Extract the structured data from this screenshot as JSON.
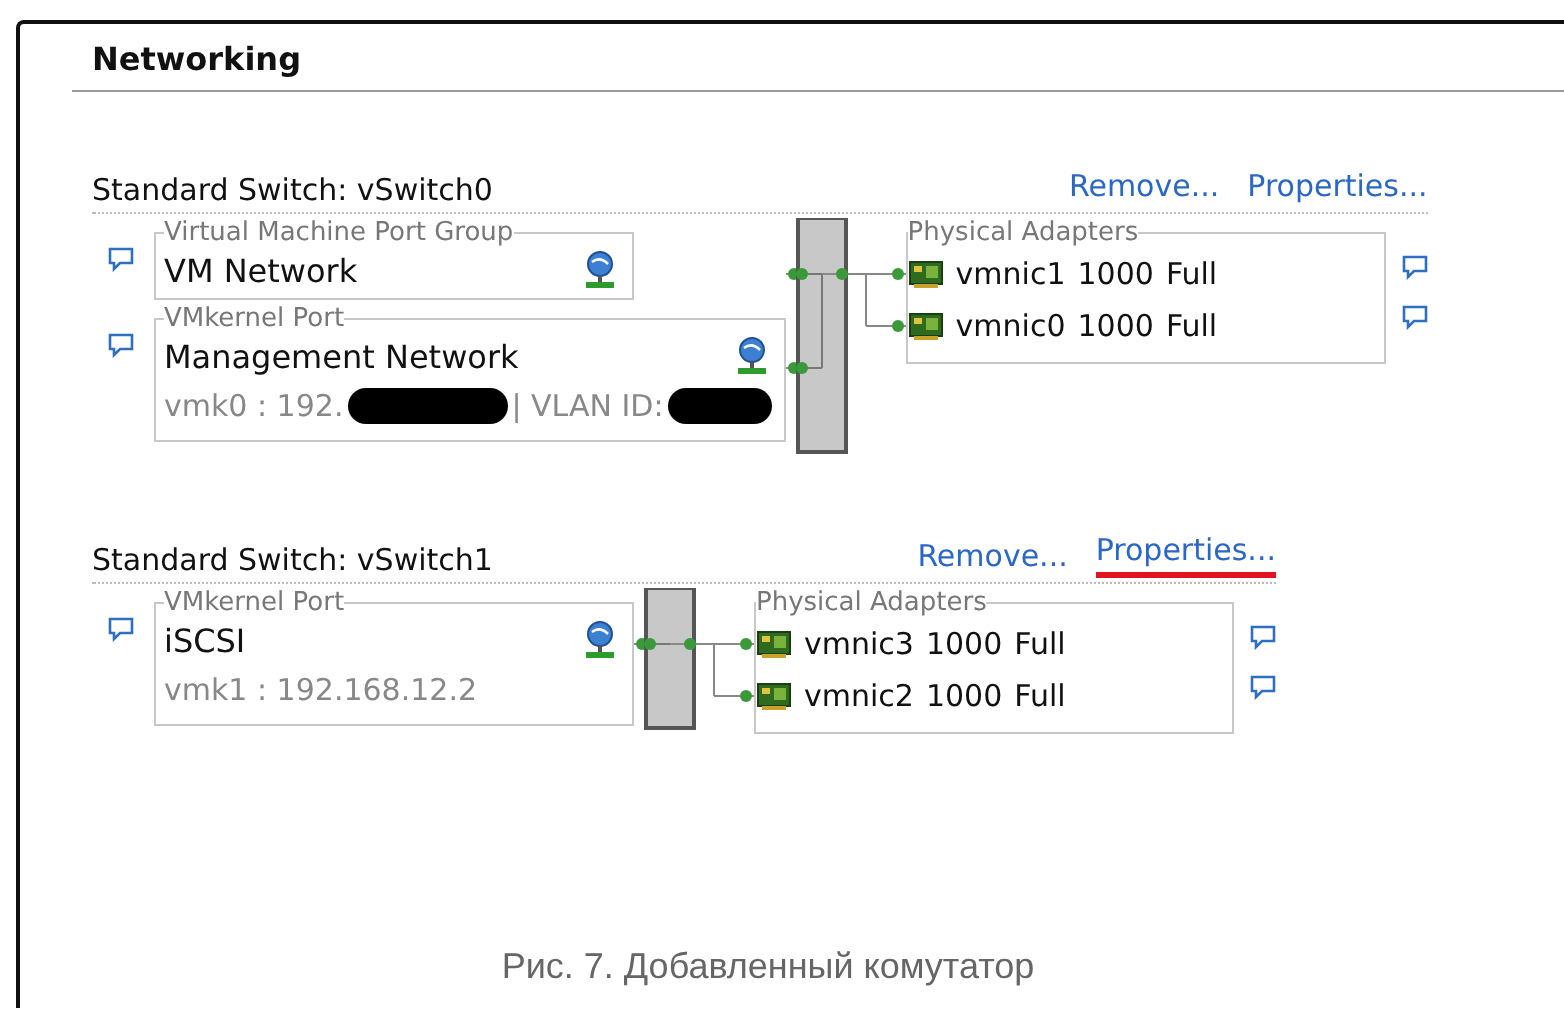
{
  "panel": {
    "title": "Networking"
  },
  "switches": [
    {
      "title": "Standard Switch: vSwitch0",
      "links": [
        {
          "label": "Remove...",
          "highlighted": false
        },
        {
          "label": "Properties...",
          "highlighted": false
        }
      ],
      "port_groups": [
        {
          "caption": "Virtual Machine Port Group",
          "name": "VM Network"
        },
        {
          "caption": "VMkernel Port",
          "name": "Management Network",
          "details": [
            {
              "kind": "text",
              "text": "vmk0 : 192."
            },
            {
              "kind": "redacted"
            },
            {
              "kind": "text",
              "text": "| VLAN ID:"
            },
            {
              "kind": "redacted"
            }
          ]
        }
      ],
      "adapters_caption": "Physical Adapters",
      "adapters": [
        {
          "name": "vmnic1",
          "speed": "1000",
          "duplex": "Full"
        },
        {
          "name": "vmnic0",
          "speed": "1000",
          "duplex": "Full"
        }
      ]
    },
    {
      "title": "Standard Switch: vSwitch1",
      "links": [
        {
          "label": "Remove...",
          "highlighted": false
        },
        {
          "label": "Properties...",
          "highlighted": true
        }
      ],
      "port_groups": [
        {
          "caption": "VMkernel Port",
          "name": "iSCSI",
          "details": [
            {
              "kind": "text",
              "text": "vmk1 : 192.168.12.2"
            }
          ]
        }
      ],
      "adapters_caption": "Physical Adapters",
      "adapters": [
        {
          "name": "vmnic3",
          "speed": "1000",
          "duplex": "Full"
        },
        {
          "name": "vmnic2",
          "speed": "1000",
          "duplex": "Full"
        }
      ]
    }
  ],
  "caption": "Рис. 7. Добавленный комутатор"
}
